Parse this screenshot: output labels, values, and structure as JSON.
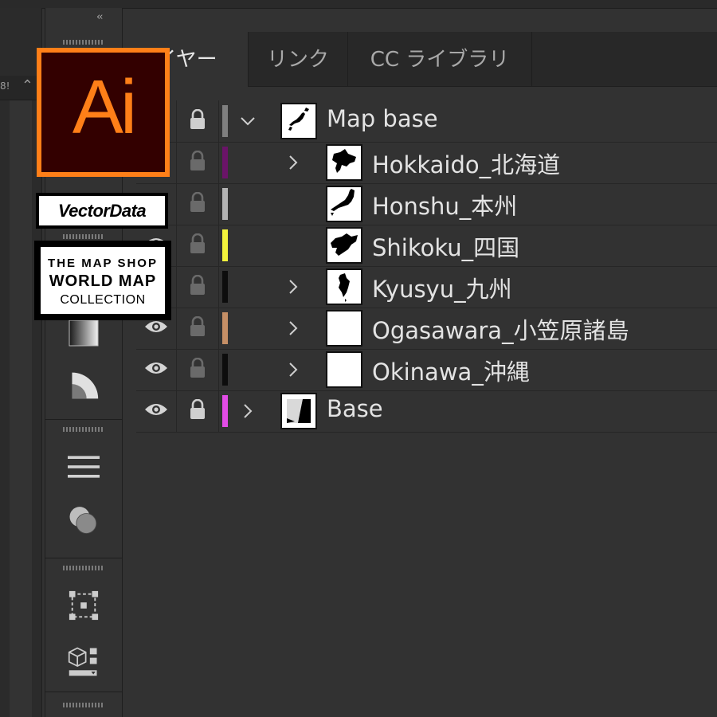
{
  "panel": {
    "tabs": [
      {
        "label": "イヤー",
        "active": true
      },
      {
        "label": "リンク",
        "active": false
      },
      {
        "label": "CC ライブラリ",
        "active": false
      }
    ],
    "collapse_icon": "double-chevron-left-icon"
  },
  "left_strip": {
    "edge_label": "8!",
    "chevron": "⌃"
  },
  "layers": [
    {
      "name": "Map base",
      "visible": false,
      "locked": true,
      "color": "#7f7f7f",
      "indent": 0,
      "expanded": true,
      "has_children": true,
      "thumb": "japan-map"
    },
    {
      "name": "Hokkaido_北海道",
      "visible": false,
      "locked": false,
      "color": "#6a1468",
      "indent": 1,
      "expanded": false,
      "has_children": true,
      "thumb": "hokkaido"
    },
    {
      "name": "Honshu_本州",
      "visible": false,
      "locked": false,
      "color": "#b3b3b3",
      "indent": 1,
      "expanded": false,
      "has_children": false,
      "thumb": "honshu"
    },
    {
      "name": "Shikoku_四国",
      "visible": true,
      "locked": false,
      "color": "#f2f23c",
      "indent": 1,
      "expanded": false,
      "has_children": false,
      "thumb": "shikoku"
    },
    {
      "name": "Kyusyu_九州",
      "visible": false,
      "locked": false,
      "color": "#0d0d0d",
      "indent": 1,
      "expanded": false,
      "has_children": true,
      "thumb": "kyushu"
    },
    {
      "name": "Ogasawara_小笠原諸島",
      "visible": true,
      "locked": false,
      "color": "#c58f66",
      "indent": 1,
      "expanded": false,
      "has_children": true,
      "thumb": "blank"
    },
    {
      "name": "Okinawa_沖縄",
      "visible": true,
      "locked": false,
      "color": "#0d0d0d",
      "indent": 1,
      "expanded": false,
      "has_children": true,
      "thumb": "blank"
    },
    {
      "name": "Base",
      "visible": true,
      "locked": true,
      "color": "#e24ce6",
      "indent": 0,
      "expanded": false,
      "has_children": true,
      "thumb": "base"
    }
  ],
  "overlays": {
    "logo_text": "Ai",
    "vectordata_text": "VectorData",
    "mapshop_line1": "THE MAP SHOP",
    "mapshop_line2": "WORLD MAP",
    "mapshop_line3": "COLLECTION"
  },
  "tools": [
    "gradient-icon",
    "pie-graph-icon",
    "align-lines-icon",
    "pathfinder-circles-icon",
    "transform-box-icon",
    "3d-cube-icon"
  ],
  "colors": {
    "accent": "#ff7f18",
    "logo_bg": "#330000",
    "panel_bg": "#323232"
  }
}
